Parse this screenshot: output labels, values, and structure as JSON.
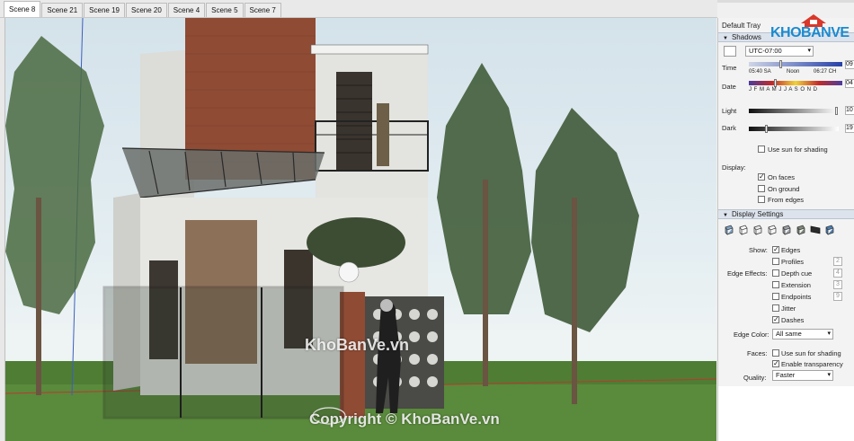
{
  "scene_tabs": [
    "Scene 8",
    "Scene 21",
    "Scene 19",
    "Scene 20",
    "Scene 4",
    "Scene 5",
    "Scene 7"
  ],
  "active_scene": "Scene 8",
  "tray": {
    "title": "Default Tray",
    "shadows": {
      "header": "Shadows",
      "timezone": "UTC-07:00",
      "time_label": "Time",
      "time_start": "05:40 SA",
      "time_noon": "Noon",
      "time_end": "06:27 CH",
      "time_value": "09",
      "date_label": "Date",
      "months": "J F M A M J J A S O N D",
      "date_value": "04",
      "light_label": "Light",
      "light_value": "10",
      "dark_label": "Dark",
      "dark_value": "19",
      "use_sun_label": "Use sun for shading",
      "display_label": "Display:",
      "on_faces": "On faces",
      "on_ground": "On ground",
      "from_edges": "From edges"
    },
    "display_settings": {
      "header": "Display Settings",
      "show_label": "Show:",
      "edges": "Edges",
      "profiles": "Profiles",
      "profiles_value": "2",
      "edge_effects_label": "Edge Effects:",
      "depth_cue": "Depth cue",
      "depth_cue_value": "4",
      "extension": "Extension",
      "extension_value": "3",
      "endpoints": "Endpoints",
      "endpoints_value": "9",
      "jitter": "Jitter",
      "dashes": "Dashes",
      "edge_color_label": "Edge Color:",
      "edge_color_value": "All same",
      "faces_label": "Faces:",
      "use_sun_faces": "Use sun for shading",
      "enable_transparency": "Enable transparency",
      "quality_label": "Quality:",
      "quality_value": "Faster"
    }
  },
  "watermarks": {
    "center": "KhoBanVe.vn",
    "copyright": "Copyright © KhoBanVe.vn",
    "logo": "KHOBANVE"
  },
  "colors": {
    "sky": "#dce7ec",
    "grass": "#4e7d33",
    "brick": "#8b4a33",
    "tray_header": "#dce3ec"
  }
}
